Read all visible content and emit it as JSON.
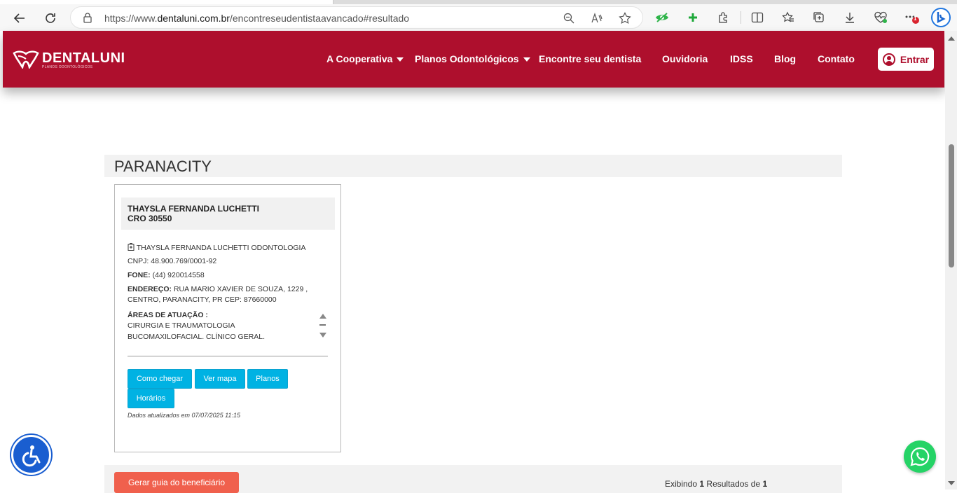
{
  "browser": {
    "url_prefix": "https://www.",
    "url_domain": "dentaluni.com.br",
    "url_path": "/encontreseudentistaavancado#resultado",
    "notification_count": "1"
  },
  "header": {
    "logo_text": "DENTALUNI",
    "logo_sub": "PLANOS ODONTOLÓGICOS",
    "menu": [
      {
        "label": "A Cooperativa"
      },
      {
        "label": "Planos Odontológicos"
      },
      {
        "label": "Encontre seu dentista"
      },
      {
        "label": "Ouvidoria"
      },
      {
        "label": "IDSS"
      },
      {
        "label": "Blog"
      },
      {
        "label": "Contato"
      }
    ],
    "login_label": "Entrar",
    "brand_color": "#ae0f2d"
  },
  "results": {
    "city": "PARANACITY",
    "card": {
      "name": "THAYSLA FERNANDA LUCHETTI",
      "cro": "CRO 30550",
      "clinic": "THAYSLA FERNANDA LUCHETTI ODONTOLOGIA",
      "cnpj": "CNPJ: 48.900.769/0001-92",
      "phone_label": "FONE:",
      "phone": "(44) 920014558",
      "address_label": "ENDEREÇO:",
      "address_line1": "RUA MARIO XAVIER DE SOUZA, 1229 ,",
      "address_line2": "CENTRO, PARANACITY, PR CEP: 87660000",
      "areas_label": "ÁREAS DE ATUAÇÃO :",
      "areas_line1": "CIRURGIA E TRAUMATOLOGIA",
      "areas_line2": "BUCOMAXILOFACIAL, CLÍNICO GERAL,",
      "buttons": {
        "directions": "Como chegar",
        "map": "Ver mapa",
        "plans": "Planos",
        "hours": "Horários"
      },
      "updated": "Dados atualizados em 07/07/2025 11:15"
    },
    "footer": {
      "generate_label": "Gerar guia do beneficiário",
      "results_prefix": "Exibindo ",
      "results_count": "1",
      "results_mid": " Resultados de ",
      "results_total": "1"
    },
    "button_color": "#00b2e3"
  }
}
